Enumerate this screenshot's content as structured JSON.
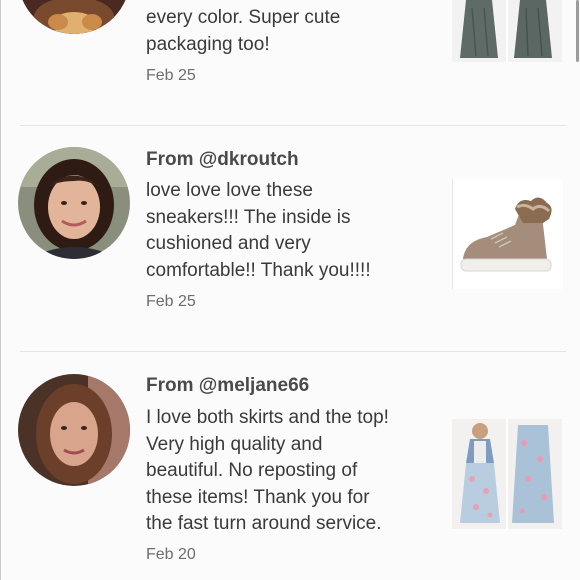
{
  "reviews": [
    {
      "author": "",
      "text": "every color. Super cute\npackaging too!",
      "date": "Feb 25",
      "avatar_icon": "user-avatar-photo",
      "thumb_icon": "green-maxi-dress-photo"
    },
    {
      "author": "From @dkroutch",
      "text": "love love love these\nsneakers!!! The inside is\ncushioned and very\ncomfortable!! Thank you!!!!",
      "date": "Feb 25",
      "avatar_icon": "user-avatar-photo",
      "thumb_icon": "fur-trim-sneaker-photo"
    },
    {
      "author": "From @meljane66",
      "text": "I love both skirts and the top!\nVery high quality and\nbeautiful. No reposting of\nthese items! Thank you for\nthe fast turn around service.",
      "date": "Feb 20",
      "avatar_icon": "user-avatar-photo",
      "thumb_icon": "floral-maxi-skirt-photo"
    }
  ],
  "colors": {
    "background": "#fcfbfc",
    "divider": "#e6e3e5",
    "text": "#3a3a3a",
    "date": "#6d6d6d"
  }
}
